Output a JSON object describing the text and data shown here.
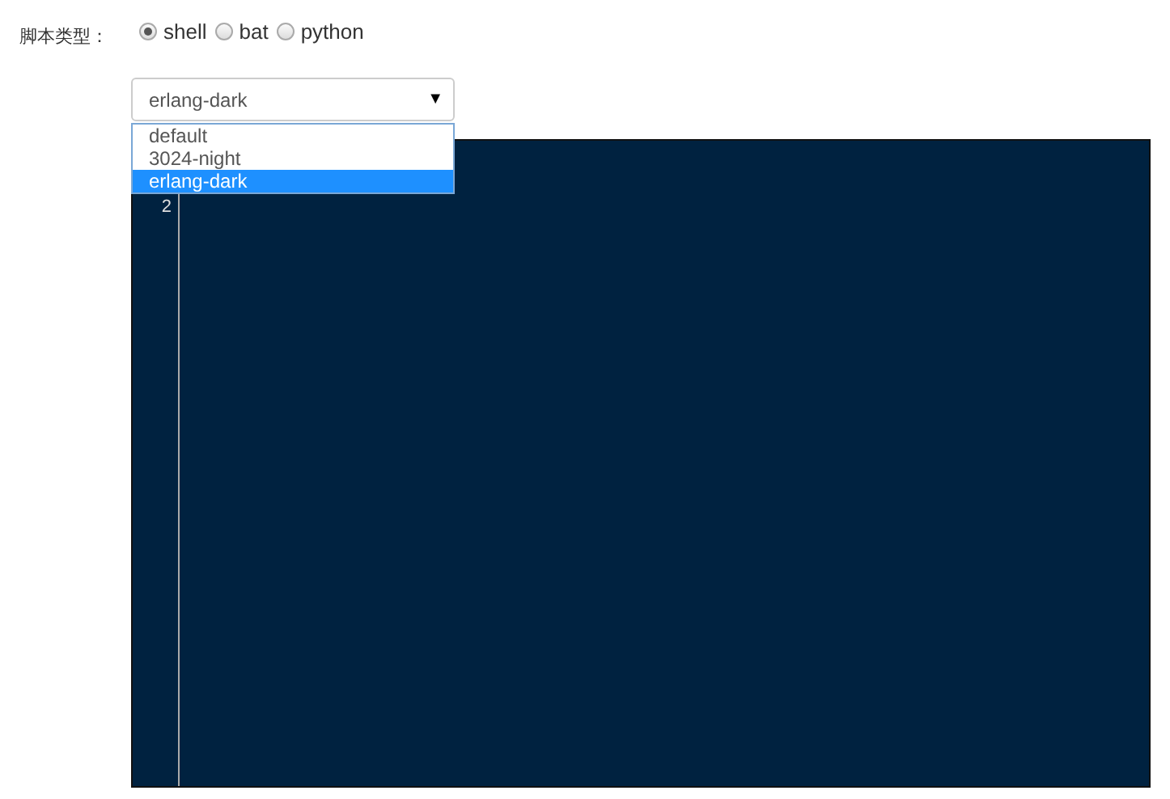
{
  "script_type": {
    "label": "脚本类型：",
    "options": [
      {
        "label": "shell",
        "selected": true
      },
      {
        "label": "bat",
        "selected": false
      },
      {
        "label": "python",
        "selected": false
      }
    ]
  },
  "theme_select": {
    "value": "erlang-dark",
    "arrow": "▼",
    "options": [
      {
        "label": "default",
        "selected": false
      },
      {
        "label": "3024-night",
        "selected": false
      },
      {
        "label": "erlang-dark",
        "selected": true
      }
    ]
  },
  "editor": {
    "line_numbers": [
      "2"
    ]
  }
}
